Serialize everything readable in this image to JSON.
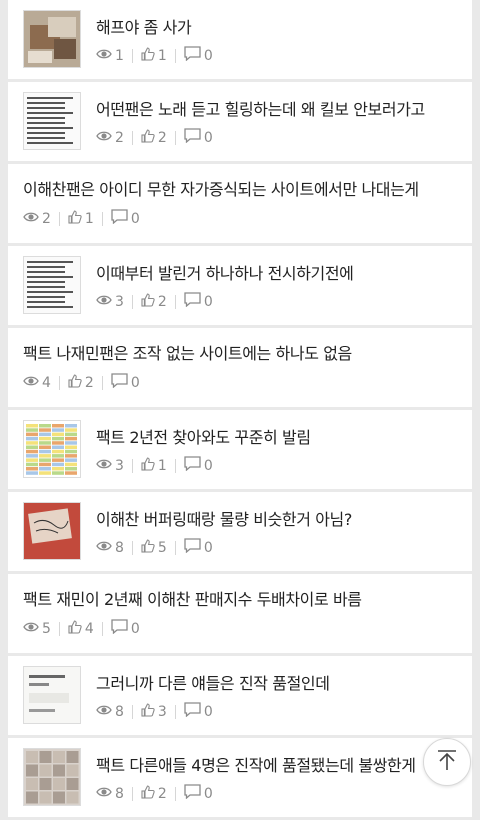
{
  "posts": [
    {
      "title": "해프야 좀 사가",
      "views": "1",
      "likes": "1",
      "comments": "0",
      "thumb": "photo-box"
    },
    {
      "title": "어떤팬은 노래 듣고 힐링하는데 왜 킬보 안보러가고",
      "views": "2",
      "likes": "2",
      "comments": "0",
      "thumb": "text-list"
    },
    {
      "title": "이해찬팬은 아이디 무한 자가증식되는 사이트에서만 나대는게",
      "views": "2",
      "likes": "1",
      "comments": "0",
      "thumb": null
    },
    {
      "title": "이때부터 발린거 하나하나 전시하기전에",
      "views": "3",
      "likes": "2",
      "comments": "0",
      "thumb": "text-list"
    },
    {
      "title": "팩트 나재민팬은 조작 없는 사이트에는 하나도 없음",
      "views": "4",
      "likes": "2",
      "comments": "0",
      "thumb": null
    },
    {
      "title": "팩트 2년전 찾아와도 꾸준히 발림",
      "views": "3",
      "likes": "1",
      "comments": "0",
      "thumb": "spreadsheet"
    },
    {
      "title": "이해찬 버퍼링때랑 물량 비슷한거 아님?",
      "views": "8",
      "likes": "5",
      "comments": "0",
      "thumb": "red-note"
    },
    {
      "title": "팩트 재민이 2년째 이해찬 판매지수 두배차이로 바름",
      "views": "5",
      "likes": "4",
      "comments": "0",
      "thumb": null
    },
    {
      "title": "그러니까 다른 얘들은 진작 품절인데",
      "views": "8",
      "likes": "3",
      "comments": "0",
      "thumb": "card-doc"
    },
    {
      "title": "팩트 다른애들 4명은 진작에 품절됐는데 불쌍한게",
      "views": "8",
      "likes": "2",
      "comments": "0",
      "thumb": "photo-grid"
    }
  ],
  "icons": {
    "views": "eye-icon",
    "likes": "thumbs-up-icon",
    "comments": "comment-icon",
    "top": "scroll-top-icon"
  },
  "colors": {
    "meta": "#8a8a8a",
    "divider": "#e9e9e9"
  }
}
